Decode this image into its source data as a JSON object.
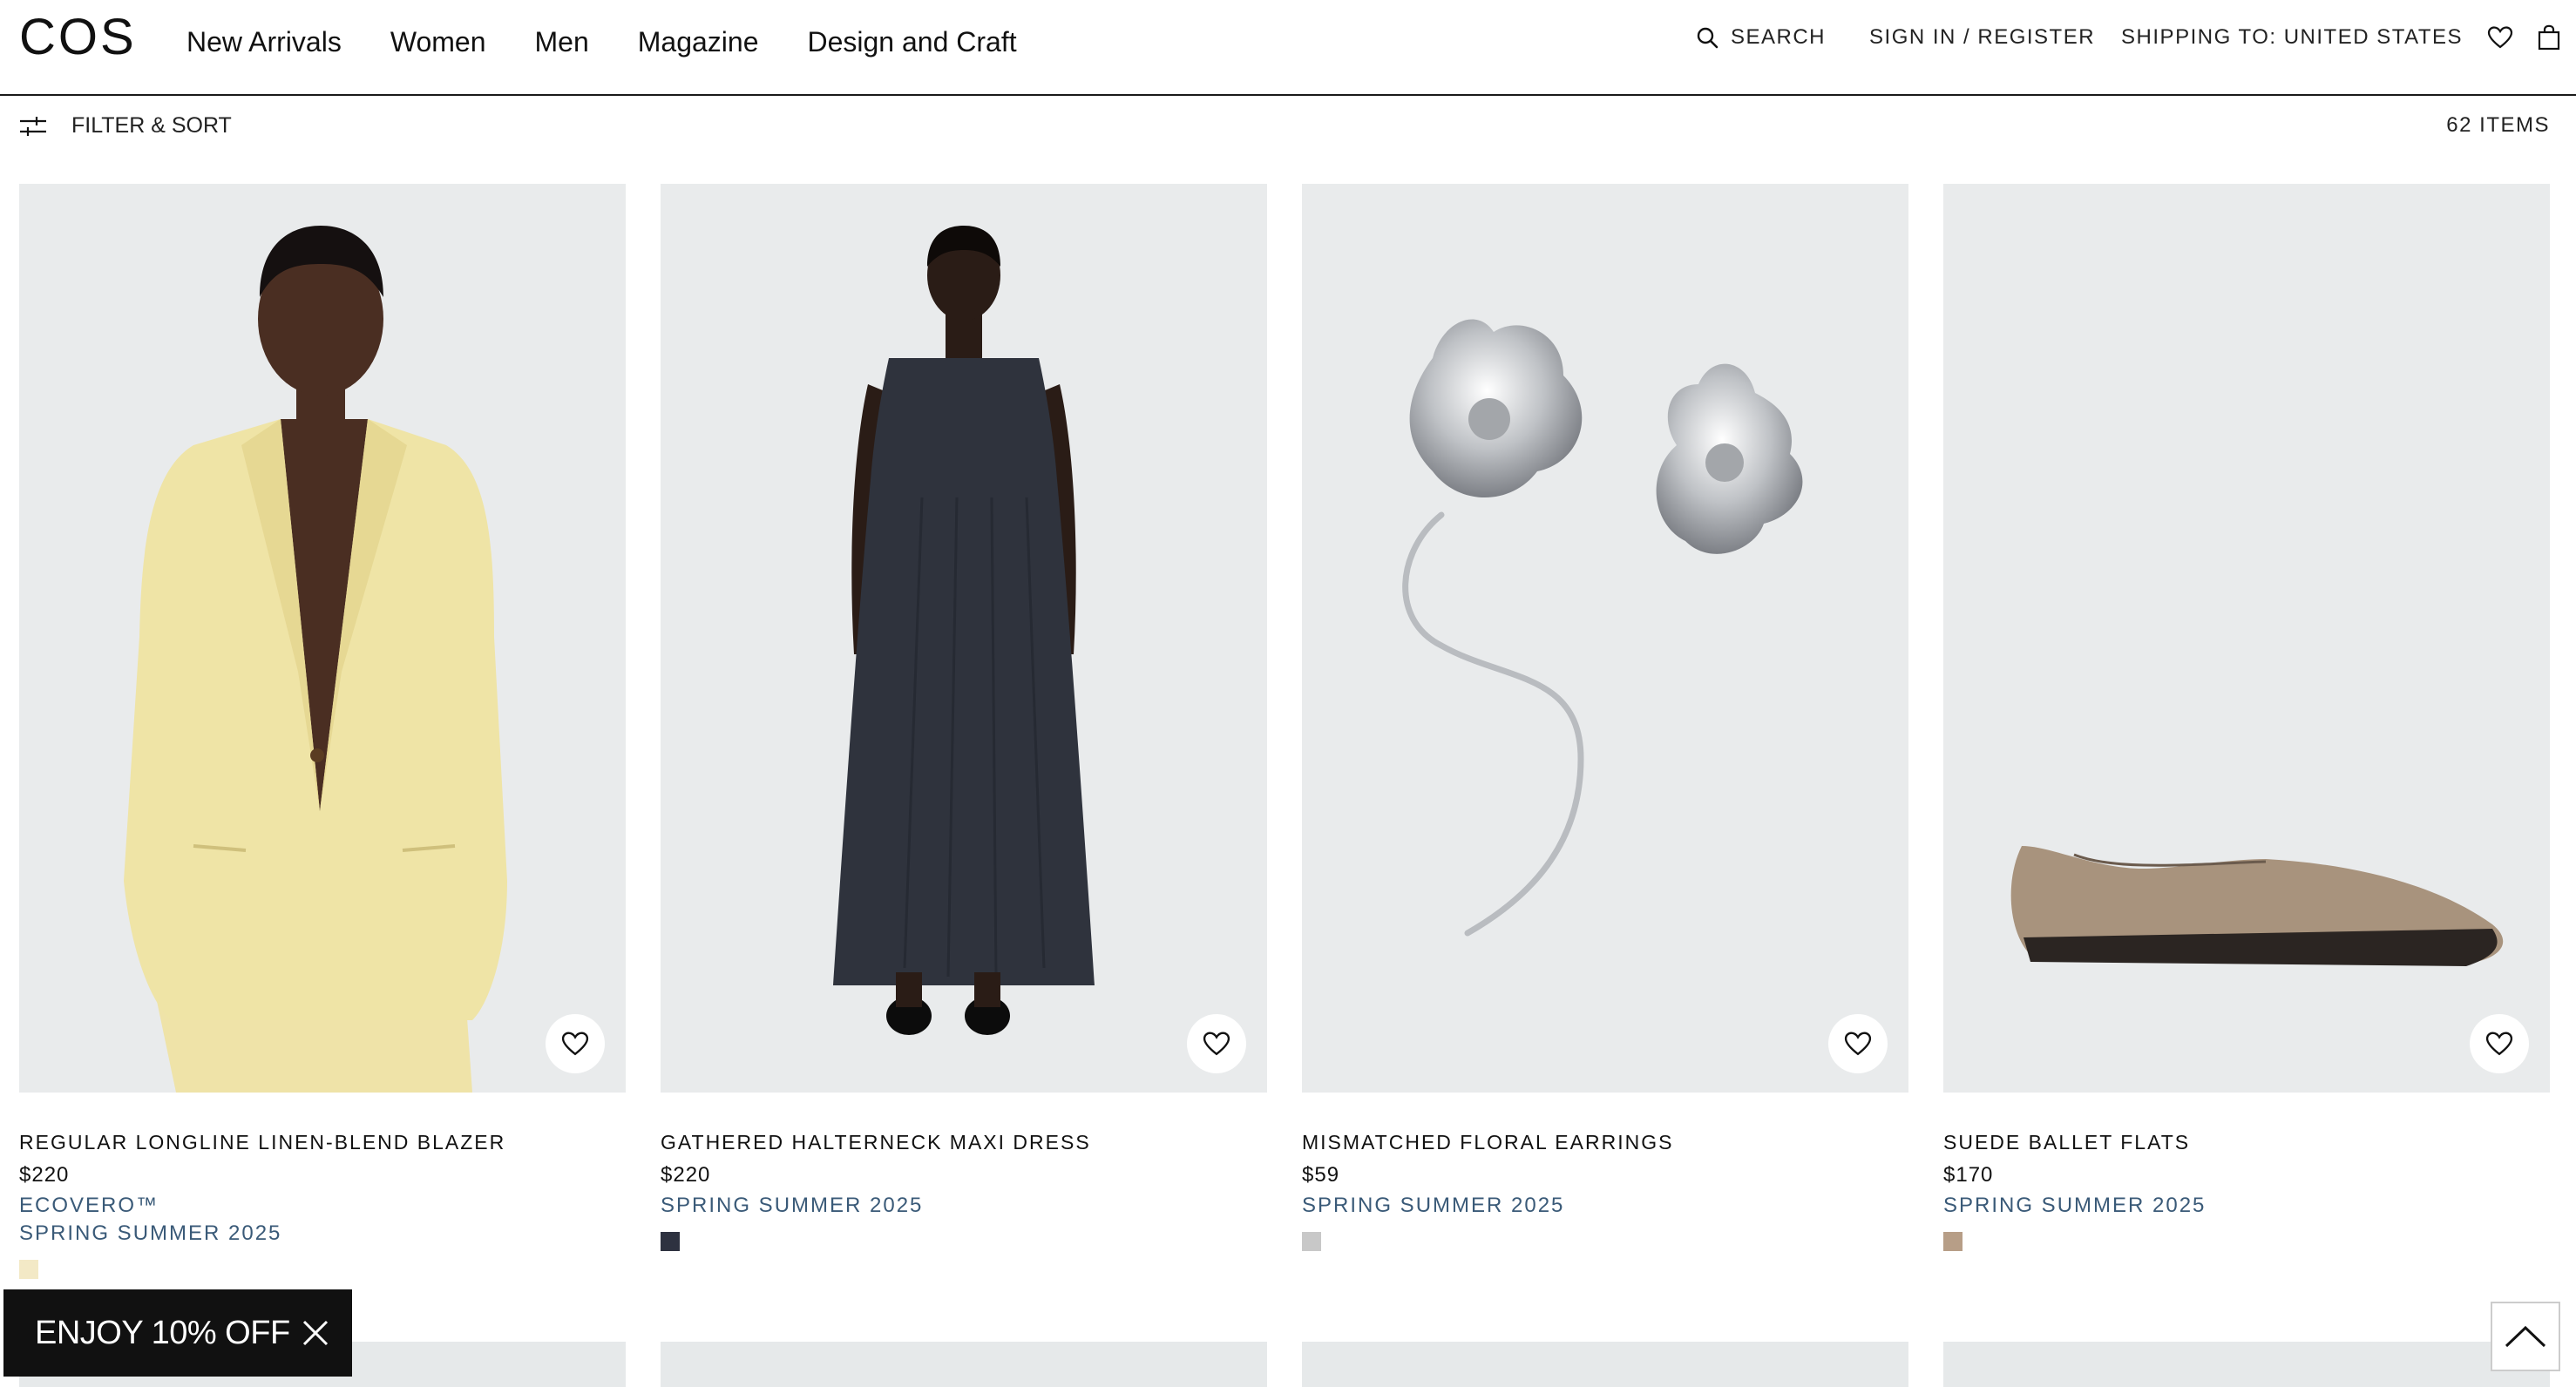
{
  "brand": {
    "logo": "COS"
  },
  "nav": [
    "New Arrivals",
    "Women",
    "Men",
    "Magazine",
    "Design and Craft"
  ],
  "utility": {
    "search_label": "SEARCH",
    "signin_label": "SIGN IN / REGISTER",
    "shipping_label": "SHIPPING TO: UNITED STATES"
  },
  "toolbar": {
    "filter_label": "FILTER & SORT",
    "items_count": "62 ITEMS"
  },
  "products": [
    {
      "name": "REGULAR LONGLINE LINEN-BLEND BLAZER",
      "price": "$220",
      "tags": [
        "ECOVERO™",
        "SPRING SUMMER 2025"
      ],
      "swatch_color": "#f3e9c6",
      "image_icon": "model-in-yellow-blazer"
    },
    {
      "name": "GATHERED HALTERNECK MAXI DRESS",
      "price": "$220",
      "tags": [
        "SPRING SUMMER 2025"
      ],
      "swatch_color": "#2e3240",
      "image_icon": "model-in-navy-dress"
    },
    {
      "name": "MISMATCHED FLORAL EARRINGS",
      "price": "$59",
      "tags": [
        "SPRING SUMMER 2025"
      ],
      "swatch_color": "#c8c8c8",
      "image_icon": "silver-floral-earrings"
    },
    {
      "name": "SUEDE BALLET FLATS",
      "price": "$170",
      "tags": [
        "SPRING SUMMER 2025"
      ],
      "swatch_color": "#b79e87",
      "image_icon": "suede-ballet-flat"
    }
  ],
  "promo": {
    "label": "ENJOY 10% OFF"
  },
  "colors": {
    "accent_link": "#3a5a78",
    "promo_bg": "#111111",
    "image_bg": "#e9ebec"
  }
}
